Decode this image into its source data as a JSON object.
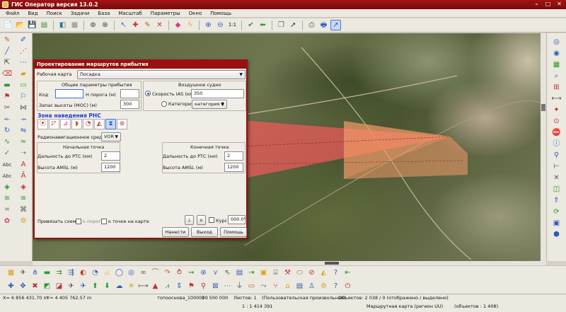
{
  "window": {
    "title": "ГИС Оператор версия 13.0.2"
  },
  "menu": [
    "Файл",
    "Вид",
    "Поиск",
    "Задачи",
    "База",
    "Масштаб",
    "Параметры",
    "Окно",
    "Помощь"
  ],
  "toolbar": {
    "zoom_label": "1:1"
  },
  "dialog": {
    "title": "Проектирование маршрутов прибытия",
    "work_map_label": "Рабочая карта",
    "work_map_value": "Посадка",
    "arrival_group_title": "Общие параметры прибытия",
    "code_label": "Код",
    "code_value": "",
    "threshold_label": "Н порога (м)",
    "threshold_value": "",
    "height_margin_label": "Запас высоты (МОС) (м)",
    "height_margin_value": "300",
    "aircraft_group_title": "Воздушное судно",
    "speed_label": "Скорость IAS (км/ч)",
    "speed_value": "350",
    "category_label": "Категория",
    "category_value": "категория С",
    "zone_header": "Зона наведения РНС",
    "radionav_label": "Радионавигационное средство",
    "radionav_value": "VOR",
    "start_point": {
      "title": "Начальная точка",
      "distance_label": "Дальность до РТС (км)",
      "distance_value": "2",
      "height_label": "Высота AMSL (м)",
      "height_value": "1200"
    },
    "end_point": {
      "title": "Конечная точка",
      "distance_label": "Дальность до РТС (км)",
      "distance_value": "2",
      "height_label": "Высота AMSL (м)",
      "height_value": "1200"
    },
    "bind_label": "Привязать схему",
    "to_threshold_label": "к порогу",
    "to_map_point_label": "к точке на карте",
    "course_label": "Курс",
    "course_value": "000.0°",
    "buttons": {
      "apply": "Нанести",
      "exit": "Выход",
      "help": "Помощь"
    }
  },
  "status": {
    "x_coord": "X= 6 856 431.70 m",
    "y_coord": "Y= 4 405 762.57 m",
    "map_name": "топооснова_1000000",
    "map_scale": "1 : 500 000",
    "sheets": "Листов: 1",
    "projection": "(Пользовательская произвольная)",
    "objects": "Объектов: 2 038 / 0 (отображено / выделено)",
    "view_scale": "1 : 1 414 391",
    "route_map": "Маршрутная карта (регион UU)",
    "route_objects": "(объектов : 1 408)"
  },
  "colors": {
    "title_bg": "#9a1010",
    "zone_red": "#e04040",
    "zone_orange": "#f08a60",
    "accent_blue": "#1c3ec8"
  }
}
